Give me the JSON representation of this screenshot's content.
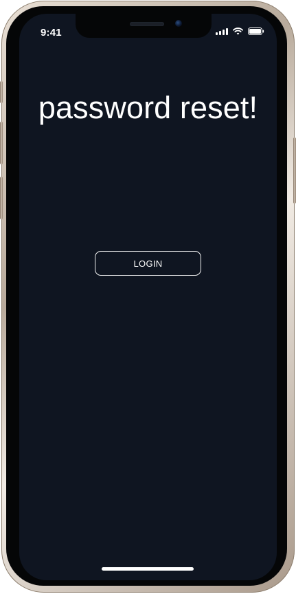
{
  "status_bar": {
    "time": "9:41",
    "signal_icon": "signal-bars-icon",
    "wifi_icon": "wifi-icon",
    "battery_icon": "battery-icon"
  },
  "main": {
    "title": "password reset!",
    "login_button_label": "LOGIN"
  },
  "theme": {
    "screen_background": "#0f1521",
    "text_color": "#ffffff",
    "button_border": "#f5f5f5",
    "phone_frame": "#c8baab"
  }
}
